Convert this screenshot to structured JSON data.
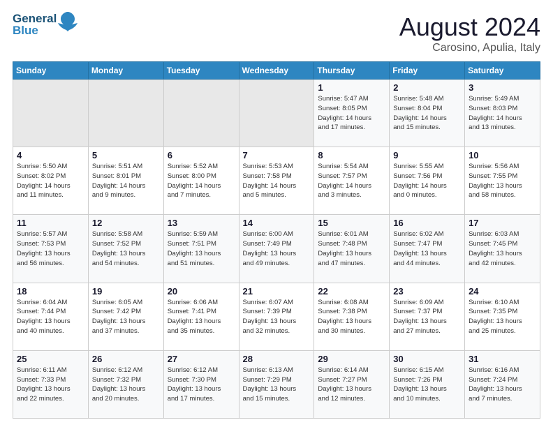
{
  "logo": {
    "part1": "General",
    "part2": "Blue"
  },
  "title": "August 2024",
  "subtitle": "Carosino, Apulia, Italy",
  "weekdays": [
    "Sunday",
    "Monday",
    "Tuesday",
    "Wednesday",
    "Thursday",
    "Friday",
    "Saturday"
  ],
  "weeks": [
    [
      {
        "day": "",
        "info": ""
      },
      {
        "day": "",
        "info": ""
      },
      {
        "day": "",
        "info": ""
      },
      {
        "day": "",
        "info": ""
      },
      {
        "day": "1",
        "info": "Sunrise: 5:47 AM\nSunset: 8:05 PM\nDaylight: 14 hours\nand 17 minutes."
      },
      {
        "day": "2",
        "info": "Sunrise: 5:48 AM\nSunset: 8:04 PM\nDaylight: 14 hours\nand 15 minutes."
      },
      {
        "day": "3",
        "info": "Sunrise: 5:49 AM\nSunset: 8:03 PM\nDaylight: 14 hours\nand 13 minutes."
      }
    ],
    [
      {
        "day": "4",
        "info": "Sunrise: 5:50 AM\nSunset: 8:02 PM\nDaylight: 14 hours\nand 11 minutes."
      },
      {
        "day": "5",
        "info": "Sunrise: 5:51 AM\nSunset: 8:01 PM\nDaylight: 14 hours\nand 9 minutes."
      },
      {
        "day": "6",
        "info": "Sunrise: 5:52 AM\nSunset: 8:00 PM\nDaylight: 14 hours\nand 7 minutes."
      },
      {
        "day": "7",
        "info": "Sunrise: 5:53 AM\nSunset: 7:58 PM\nDaylight: 14 hours\nand 5 minutes."
      },
      {
        "day": "8",
        "info": "Sunrise: 5:54 AM\nSunset: 7:57 PM\nDaylight: 14 hours\nand 3 minutes."
      },
      {
        "day": "9",
        "info": "Sunrise: 5:55 AM\nSunset: 7:56 PM\nDaylight: 14 hours\nand 0 minutes."
      },
      {
        "day": "10",
        "info": "Sunrise: 5:56 AM\nSunset: 7:55 PM\nDaylight: 13 hours\nand 58 minutes."
      }
    ],
    [
      {
        "day": "11",
        "info": "Sunrise: 5:57 AM\nSunset: 7:53 PM\nDaylight: 13 hours\nand 56 minutes."
      },
      {
        "day": "12",
        "info": "Sunrise: 5:58 AM\nSunset: 7:52 PM\nDaylight: 13 hours\nand 54 minutes."
      },
      {
        "day": "13",
        "info": "Sunrise: 5:59 AM\nSunset: 7:51 PM\nDaylight: 13 hours\nand 51 minutes."
      },
      {
        "day": "14",
        "info": "Sunrise: 6:00 AM\nSunset: 7:49 PM\nDaylight: 13 hours\nand 49 minutes."
      },
      {
        "day": "15",
        "info": "Sunrise: 6:01 AM\nSunset: 7:48 PM\nDaylight: 13 hours\nand 47 minutes."
      },
      {
        "day": "16",
        "info": "Sunrise: 6:02 AM\nSunset: 7:47 PM\nDaylight: 13 hours\nand 44 minutes."
      },
      {
        "day": "17",
        "info": "Sunrise: 6:03 AM\nSunset: 7:45 PM\nDaylight: 13 hours\nand 42 minutes."
      }
    ],
    [
      {
        "day": "18",
        "info": "Sunrise: 6:04 AM\nSunset: 7:44 PM\nDaylight: 13 hours\nand 40 minutes."
      },
      {
        "day": "19",
        "info": "Sunrise: 6:05 AM\nSunset: 7:42 PM\nDaylight: 13 hours\nand 37 minutes."
      },
      {
        "day": "20",
        "info": "Sunrise: 6:06 AM\nSunset: 7:41 PM\nDaylight: 13 hours\nand 35 minutes."
      },
      {
        "day": "21",
        "info": "Sunrise: 6:07 AM\nSunset: 7:39 PM\nDaylight: 13 hours\nand 32 minutes."
      },
      {
        "day": "22",
        "info": "Sunrise: 6:08 AM\nSunset: 7:38 PM\nDaylight: 13 hours\nand 30 minutes."
      },
      {
        "day": "23",
        "info": "Sunrise: 6:09 AM\nSunset: 7:37 PM\nDaylight: 13 hours\nand 27 minutes."
      },
      {
        "day": "24",
        "info": "Sunrise: 6:10 AM\nSunset: 7:35 PM\nDaylight: 13 hours\nand 25 minutes."
      }
    ],
    [
      {
        "day": "25",
        "info": "Sunrise: 6:11 AM\nSunset: 7:33 PM\nDaylight: 13 hours\nand 22 minutes."
      },
      {
        "day": "26",
        "info": "Sunrise: 6:12 AM\nSunset: 7:32 PM\nDaylight: 13 hours\nand 20 minutes."
      },
      {
        "day": "27",
        "info": "Sunrise: 6:12 AM\nSunset: 7:30 PM\nDaylight: 13 hours\nand 17 minutes."
      },
      {
        "day": "28",
        "info": "Sunrise: 6:13 AM\nSunset: 7:29 PM\nDaylight: 13 hours\nand 15 minutes."
      },
      {
        "day": "29",
        "info": "Sunrise: 6:14 AM\nSunset: 7:27 PM\nDaylight: 13 hours\nand 12 minutes."
      },
      {
        "day": "30",
        "info": "Sunrise: 6:15 AM\nSunset: 7:26 PM\nDaylight: 13 hours\nand 10 minutes."
      },
      {
        "day": "31",
        "info": "Sunrise: 6:16 AM\nSunset: 7:24 PM\nDaylight: 13 hours\nand 7 minutes."
      }
    ]
  ]
}
